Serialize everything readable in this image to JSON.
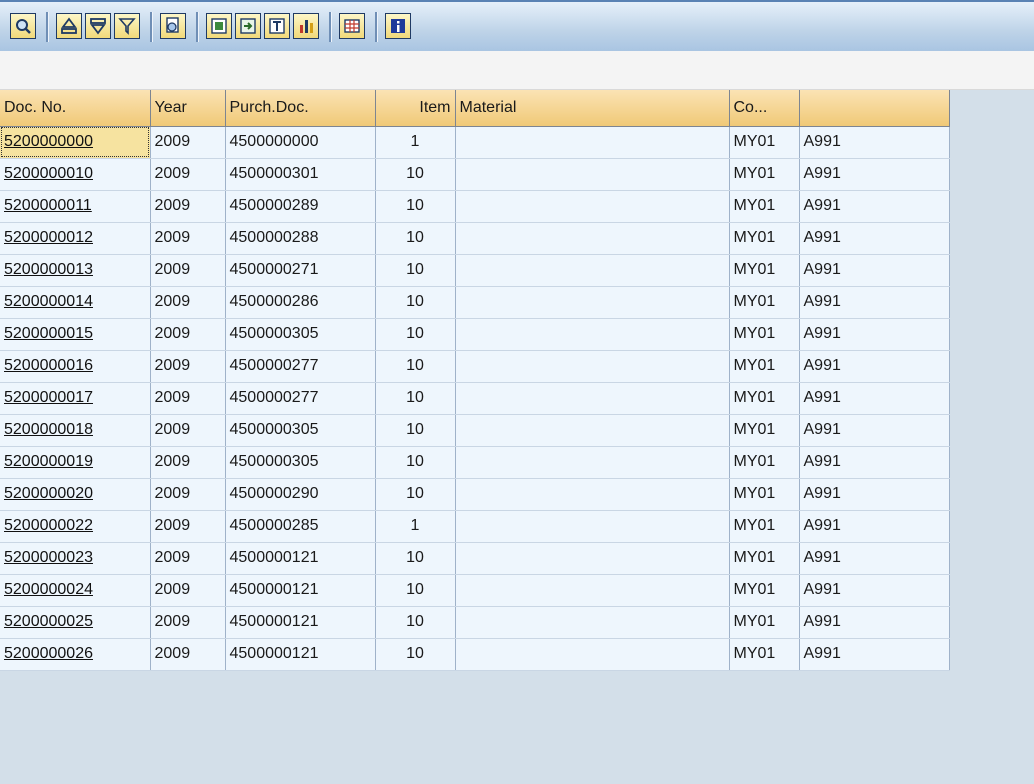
{
  "toolbar": {
    "buttons": [
      {
        "icon": "details-icon"
      },
      {
        "icon": "sort-ascending-icon"
      },
      {
        "icon": "sort-descending-icon"
      },
      {
        "icon": "filter-icon"
      },
      {
        "icon": "print-preview-icon"
      },
      {
        "icon": "export-icon"
      },
      {
        "icon": "send-icon"
      },
      {
        "icon": "layout-icon"
      },
      {
        "icon": "graphic-icon"
      },
      {
        "icon": "spreadsheet-icon"
      },
      {
        "icon": "info-icon"
      }
    ]
  },
  "table": {
    "headers": {
      "doc_no": "Doc. No.",
      "year": "Year",
      "purch_doc": "Purch.Doc.",
      "item": "Item",
      "material": "Material",
      "co": "Co...",
      "last": ""
    },
    "rows": [
      {
        "doc_no": "5200000000",
        "year": "2009",
        "purch_doc": "4500000000",
        "item": "1",
        "material": "",
        "co": "MY01",
        "last": "A991"
      },
      {
        "doc_no": "5200000010",
        "year": "2009",
        "purch_doc": "4500000301",
        "item": "10",
        "material": "",
        "co": "MY01",
        "last": "A991"
      },
      {
        "doc_no": "5200000011",
        "year": "2009",
        "purch_doc": "4500000289",
        "item": "10",
        "material": "",
        "co": "MY01",
        "last": "A991"
      },
      {
        "doc_no": "5200000012",
        "year": "2009",
        "purch_doc": "4500000288",
        "item": "10",
        "material": "",
        "co": "MY01",
        "last": "A991"
      },
      {
        "doc_no": "5200000013",
        "year": "2009",
        "purch_doc": "4500000271",
        "item": "10",
        "material": "",
        "co": "MY01",
        "last": "A991"
      },
      {
        "doc_no": "5200000014",
        "year": "2009",
        "purch_doc": "4500000286",
        "item": "10",
        "material": "",
        "co": "MY01",
        "last": "A991"
      },
      {
        "doc_no": "5200000015",
        "year": "2009",
        "purch_doc": "4500000305",
        "item": "10",
        "material": "",
        "co": "MY01",
        "last": "A991"
      },
      {
        "doc_no": "5200000016",
        "year": "2009",
        "purch_doc": "4500000277",
        "item": "10",
        "material": "",
        "co": "MY01",
        "last": "A991"
      },
      {
        "doc_no": "5200000017",
        "year": "2009",
        "purch_doc": "4500000277",
        "item": "10",
        "material": "",
        "co": "MY01",
        "last": "A991"
      },
      {
        "doc_no": "5200000018",
        "year": "2009",
        "purch_doc": "4500000305",
        "item": "10",
        "material": "",
        "co": "MY01",
        "last": "A991"
      },
      {
        "doc_no": "5200000019",
        "year": "2009",
        "purch_doc": "4500000305",
        "item": "10",
        "material": "",
        "co": "MY01",
        "last": "A991"
      },
      {
        "doc_no": "5200000020",
        "year": "2009",
        "purch_doc": "4500000290",
        "item": "10",
        "material": "",
        "co": "MY01",
        "last": "A991"
      },
      {
        "doc_no": "5200000022",
        "year": "2009",
        "purch_doc": "4500000285",
        "item": "1",
        "material": "",
        "co": "MY01",
        "last": "A991"
      },
      {
        "doc_no": "5200000023",
        "year": "2009",
        "purch_doc": "4500000121",
        "item": "10",
        "material": "",
        "co": "MY01",
        "last": "A991"
      },
      {
        "doc_no": "5200000024",
        "year": "2009",
        "purch_doc": "4500000121",
        "item": "10",
        "material": "",
        "co": "MY01",
        "last": "A991"
      },
      {
        "doc_no": "5200000025",
        "year": "2009",
        "purch_doc": "4500000121",
        "item": "10",
        "material": "",
        "co": "MY01",
        "last": "A991"
      },
      {
        "doc_no": "5200000026",
        "year": "2009",
        "purch_doc": "4500000121",
        "item": "10",
        "material": "",
        "co": "MY01",
        "last": "A991"
      }
    ]
  }
}
